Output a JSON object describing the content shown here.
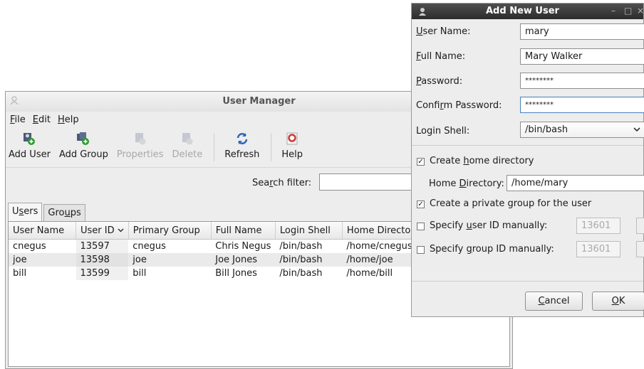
{
  "user_manager": {
    "title": "User Manager",
    "menu": [
      {
        "mn": "F",
        "rest": "ile"
      },
      {
        "mn": "E",
        "rest": "dit"
      },
      {
        "mn": "H",
        "rest": "elp"
      }
    ],
    "toolbar": {
      "add_user": "Add User",
      "add_group": "Add Group",
      "properties": "Properties",
      "delete": "Delete",
      "refresh": "Refresh",
      "help": "Help"
    },
    "search": {
      "pre": "Sea",
      "mn": "r",
      "post": "ch filter:",
      "value": ""
    },
    "tabs": [
      {
        "pre": "U",
        "mn": "s",
        "post": "ers"
      },
      {
        "pre": "Gro",
        "mn": "u",
        "post": "ps"
      }
    ],
    "columns": [
      "User Name",
      "User ID",
      "Primary Group",
      "Full Name",
      "Login Shell",
      "Home Director"
    ],
    "sort_indicator": "chevron-down",
    "rows": [
      [
        "cnegus",
        "13597",
        "cnegus",
        "Chris Negus",
        "/bin/bash",
        "/home/cnegus"
      ],
      [
        "joe",
        "13598",
        "joe",
        "Joe Jones",
        "/bin/bash",
        "/home/joe"
      ],
      [
        "bill",
        "13599",
        "bill",
        "Bill Jones",
        "/bin/bash",
        "/home/bill"
      ]
    ]
  },
  "add_new_user": {
    "title": "Add New User",
    "user_name": {
      "mn": "U",
      "rest": "ser Name:",
      "value": "mary"
    },
    "full_name": {
      "mn": "F",
      "rest": "ull Name:",
      "value": "Mary Walker"
    },
    "password": {
      "mn": "P",
      "rest": "assword:",
      "value": "********"
    },
    "confirm_password": {
      "pre": "Confi",
      "mn": "r",
      "post": "m Password:",
      "value": "********"
    },
    "login_shell": {
      "label": "Login Shell:",
      "value": "/bin/bash"
    },
    "create_home": {
      "pre": "Create ",
      "mn": "h",
      "post": "ome directory",
      "checked": true
    },
    "home_directory": {
      "pre": "Home ",
      "mn": "D",
      "post": "irectory:",
      "value": "/home/mary"
    },
    "private_group": {
      "label": "Create a private group for the user",
      "checked": true
    },
    "specify_uid": {
      "pre": "Specify ",
      "mn": "u",
      "post": "ser ID manually:",
      "checked": false,
      "value": "13601"
    },
    "specify_gid": {
      "pre": "Specify ",
      "mn": "g",
      "post": "roup ID manually:",
      "checked": false,
      "value": "13601"
    },
    "cancel": {
      "mn": "C",
      "rest": "ancel"
    },
    "ok": {
      "mn": "O",
      "rest": "K"
    }
  },
  "colors": {
    "focus_border": "#4a7fbf",
    "dialog_titlebar": "#3a3a3a",
    "window_bg": "#ededed"
  }
}
